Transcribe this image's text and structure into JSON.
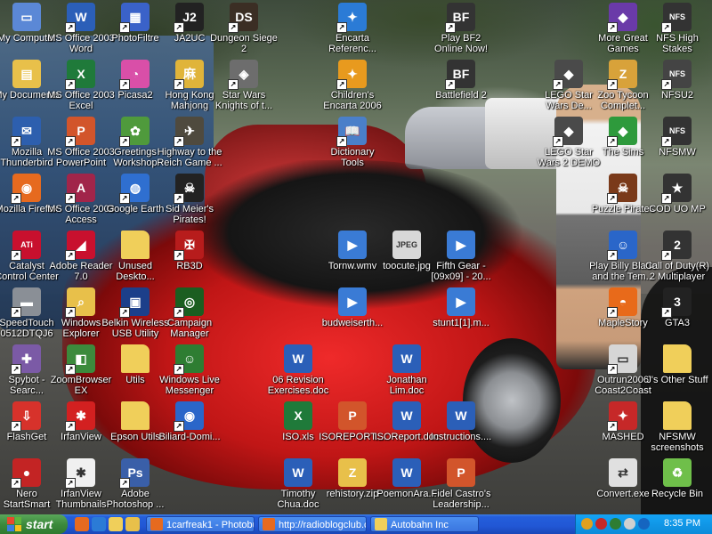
{
  "desktop": {
    "icons": [
      {
        "label": "My Computer",
        "icon": "computer-icon",
        "color": "#5b88d6",
        "glyph": "▭",
        "shortcut": false
      },
      {
        "label": "My Documents",
        "icon": "folder-documents-icon",
        "color": "#e8c04a",
        "glyph": "▤",
        "shortcut": false
      },
      {
        "label": "Mozilla Thunderbird",
        "icon": "thunderbird-icon",
        "color": "#2d5fae",
        "glyph": "✉",
        "shortcut": true
      },
      {
        "label": "Mozilla Firefox",
        "icon": "firefox-icon",
        "color": "#e66a1f",
        "glyph": "◉",
        "shortcut": true
      },
      {
        "label": "Catalyst Control Center",
        "icon": "ati-icon",
        "color": "#c8102e",
        "glyph": "ATi",
        "shortcut": true
      },
      {
        "label": "SpeedTouch 0512DTQJ6",
        "icon": "modem-icon",
        "color": "#8a8f96",
        "glyph": "▬",
        "shortcut": true
      },
      {
        "label": "Spybot - Searc...",
        "icon": "spybot-icon",
        "color": "#7b5aa6",
        "glyph": "✚",
        "shortcut": true
      },
      {
        "label": "FlashGet",
        "icon": "flashget-icon",
        "color": "#d7322b",
        "glyph": "⇩",
        "shortcut": true
      },
      {
        "label": "Nero StartSmart",
        "icon": "nero-icon",
        "color": "#c32424",
        "glyph": "●",
        "shortcut": true
      },
      {
        "label": "MS Office 2003 Word",
        "icon": "word-icon",
        "color": "#2b5fb8",
        "glyph": "W",
        "shortcut": true
      },
      {
        "label": "MS Office 2003 Excel",
        "icon": "excel-icon",
        "color": "#1f7a3a",
        "glyph": "X",
        "shortcut": true
      },
      {
        "label": "MS Office 2003 PowerPoint",
        "icon": "powerpoint-icon",
        "color": "#d2552b",
        "glyph": "P",
        "shortcut": true
      },
      {
        "label": "MS Office 2003 Access",
        "icon": "access-icon",
        "color": "#a1254a",
        "glyph": "A",
        "shortcut": true
      },
      {
        "label": "Adobe Reader 7.0",
        "icon": "adobe-reader-icon",
        "color": "#c8102e",
        "glyph": "◢",
        "shortcut": true
      },
      {
        "label": "Windows Explorer",
        "icon": "explorer-icon",
        "color": "#e8c04a",
        "glyph": "⌕",
        "shortcut": true
      },
      {
        "label": "ZoomBrowser EX",
        "icon": "zoombrowser-icon",
        "color": "#3c8a3c",
        "glyph": "◧",
        "shortcut": true
      },
      {
        "label": "IrfanView",
        "icon": "irfanview-icon",
        "color": "#d32020",
        "glyph": "✱",
        "shortcut": true
      },
      {
        "label": "IrfanView Thumbnails",
        "icon": "irfanview-thumbnails-icon",
        "color": "#f0f0f0",
        "glyph": "✱",
        "shortcut": true
      },
      {
        "label": "PhotoFiltre",
        "icon": "photofiltre-icon",
        "color": "#3a62c9",
        "glyph": "▦",
        "shortcut": true
      },
      {
        "label": "Picasa2",
        "icon": "picasa-icon",
        "color": "#d94fa8",
        "glyph": "◔",
        "shortcut": true
      },
      {
        "label": "Greetings Workshop",
        "icon": "greetings-icon",
        "color": "#4f9a3c",
        "glyph": "✿",
        "shortcut": true
      },
      {
        "label": "Google Earth",
        "icon": "google-earth-icon",
        "color": "#2f6fd0",
        "glyph": "◍",
        "shortcut": true
      },
      {
        "label": "Unused Deskto...",
        "icon": "folder-icon",
        "color": "#f0cf5a",
        "glyph": "",
        "shortcut": false
      },
      {
        "label": "Belkin Wireless USB Utility",
        "icon": "belkin-icon",
        "color": "#1c3f8a",
        "glyph": "▣",
        "shortcut": true
      },
      {
        "label": "Utils",
        "icon": "folder-icon",
        "color": "#f0cf5a",
        "glyph": "",
        "shortcut": false
      },
      {
        "label": "Epson Utils",
        "icon": "folder-icon",
        "color": "#f0cf5a",
        "glyph": "",
        "shortcut": false
      },
      {
        "label": "Adobe Photoshop ...",
        "icon": "photoshop-icon",
        "color": "#3a5fa8",
        "glyph": "Ps",
        "shortcut": true
      },
      {
        "label": "JA2UC",
        "icon": "ja2uc-icon",
        "color": "#222222",
        "glyph": "J2",
        "shortcut": true
      },
      {
        "label": "Hong Kong Mahjong",
        "icon": "mahjong-icon",
        "color": "#e0b43a",
        "glyph": "麻",
        "shortcut": true
      },
      {
        "label": "Highway to the Reich Game ...",
        "icon": "highway-reich-icon",
        "color": "#4f4a3e",
        "glyph": "✈",
        "shortcut": true
      },
      {
        "label": "Sid Meier's Pirates!",
        "icon": "pirates-icon",
        "color": "#222222",
        "glyph": "☠",
        "shortcut": true
      },
      {
        "label": "RB3D",
        "icon": "rb3d-icon",
        "color": "#b71c1c",
        "glyph": "✠",
        "shortcut": true
      },
      {
        "label": "Campaign Manager",
        "icon": "campaign-manager-icon",
        "color": "#1b5e20",
        "glyph": "◎",
        "shortcut": true
      },
      {
        "label": "Windows Live Messenger",
        "icon": "messenger-icon",
        "color": "#2e7d32",
        "glyph": "☺",
        "shortcut": true
      },
      {
        "label": "Biliard-Domi...",
        "icon": "billiard-icon",
        "color": "#2a66c9",
        "glyph": "◉",
        "shortcut": true
      },
      {
        "label": "Dungeon Siege 2",
        "icon": "dungeon-siege-icon",
        "color": "#3b2e24",
        "glyph": "DS",
        "shortcut": true
      },
      {
        "label": "Star Wars Knights of t...",
        "icon": "kotor-icon",
        "color": "#6d6d6d",
        "glyph": "◈",
        "shortcut": true
      },
      {
        "label": "Encarta Referenc...",
        "icon": "encarta-icon",
        "color": "#2b7bd6",
        "glyph": "✦",
        "shortcut": true
      },
      {
        "label": "Children's Encarta 2006",
        "icon": "childrens-encarta-icon",
        "color": "#e89a1e",
        "glyph": "✦",
        "shortcut": true
      },
      {
        "label": "Dictionary Tools",
        "icon": "dictionary-icon",
        "color": "#4a7fc9",
        "glyph": "📖",
        "shortcut": true
      },
      {
        "label": "Tornw.wmv",
        "icon": "video-file-icon",
        "color": "#3a7bd5",
        "glyph": "▶",
        "shortcut": false
      },
      {
        "label": "budweiserth...",
        "icon": "video-file-icon",
        "color": "#3a7bd5",
        "glyph": "▶",
        "shortcut": false
      },
      {
        "label": "06 Revision Exercises.doc",
        "icon": "word-doc-icon",
        "color": "#2b5fb8",
        "glyph": "W",
        "shortcut": false
      },
      {
        "label": "ISO.xls",
        "icon": "excel-doc-icon",
        "color": "#1f7a3a",
        "glyph": "X",
        "shortcut": false
      },
      {
        "label": "Timothy Chua.doc",
        "icon": "word-doc-icon",
        "color": "#2b5fb8",
        "glyph": "W",
        "shortcut": false
      },
      {
        "label": "toocute.jpg",
        "icon": "jpeg-file-icon",
        "color": "#d8d8d8",
        "glyph": "JPEG",
        "shortcut": false
      },
      {
        "label": "Jonathan Lim.doc",
        "icon": "word-doc-icon",
        "color": "#2b5fb8",
        "glyph": "W",
        "shortcut": false
      },
      {
        "label": "ISOREPORT....",
        "icon": "ppt-doc-icon",
        "color": "#d2552b",
        "glyph": "P",
        "shortcut": false
      },
      {
        "label": "ISOReport.doc",
        "icon": "word-doc-icon",
        "color": "#2b5fb8",
        "glyph": "W",
        "shortcut": false
      },
      {
        "label": "rehistory.zip",
        "icon": "zip-file-icon",
        "color": "#e8c04a",
        "glyph": "Z",
        "shortcut": false
      },
      {
        "label": "PoemonAra...",
        "icon": "word-doc-icon",
        "color": "#2b5fb8",
        "glyph": "W",
        "shortcut": false
      },
      {
        "label": "Play BF2 Online Now!",
        "icon": "battlefield-online-icon",
        "color": "#333333",
        "glyph": "BF",
        "shortcut": true
      },
      {
        "label": "Battlefield 2",
        "icon": "battlefield-icon",
        "color": "#333333",
        "glyph": "BF",
        "shortcut": true
      },
      {
        "label": "Fifth Gear - [09x09] - 20...",
        "icon": "video-file-icon",
        "color": "#3a7bd5",
        "glyph": "▶",
        "shortcut": false
      },
      {
        "label": "stunt1[1].m...",
        "icon": "video-file-icon",
        "color": "#3a7bd5",
        "glyph": "▶",
        "shortcut": false
      },
      {
        "label": "Instructions....",
        "icon": "word-doc-icon",
        "color": "#2b5fb8",
        "glyph": "W",
        "shortcut": false
      },
      {
        "label": "Fidel Castro's Leadership...",
        "icon": "ppt-doc-icon",
        "color": "#d2552b",
        "glyph": "P",
        "shortcut": false
      },
      {
        "label": "LEGO Star Wars De...",
        "icon": "lego-star-wars-icon",
        "color": "#4a4a4a",
        "glyph": "◆",
        "shortcut": true
      },
      {
        "label": "LEGO Star Wars 2 DEMO",
        "icon": "lego-star-wars-2-icon",
        "color": "#4a4a4a",
        "glyph": "◆",
        "shortcut": true
      },
      {
        "label": "More Great Games",
        "icon": "more-games-icon",
        "color": "#6a3aa8",
        "glyph": "◆",
        "shortcut": true
      },
      {
        "label": "Zoo Tycoon Complet...",
        "icon": "zoo-tycoon-icon",
        "color": "#d8a23a",
        "glyph": "Z",
        "shortcut": true
      },
      {
        "label": "The Sims",
        "icon": "sims-icon",
        "color": "#2e9a3c",
        "glyph": "◆",
        "shortcut": true
      },
      {
        "label": "Puzzle Pirates",
        "icon": "puzzle-pirates-icon",
        "color": "#7a3a1a",
        "glyph": "☠",
        "shortcut": true
      },
      {
        "label": "Play Billy Blade and the Tem...",
        "icon": "billy-blade-icon",
        "color": "#2a66c9",
        "glyph": "☺",
        "shortcut": true
      },
      {
        "label": "MapleStory",
        "icon": "maplestory-icon",
        "color": "#e86a1a",
        "glyph": "◓",
        "shortcut": true
      },
      {
        "label": "Outrun2006 Coast2Coast",
        "icon": "outrun-icon",
        "color": "#d6d6d6",
        "glyph": "▭",
        "shortcut": true
      },
      {
        "label": "MASHED",
        "icon": "mashed-icon",
        "color": "#c62828",
        "glyph": "✦",
        "shortcut": true
      },
      {
        "label": "Convert.exe",
        "icon": "convert-exe-icon",
        "color": "#e0e0e0",
        "glyph": "⇄",
        "shortcut": false
      },
      {
        "label": "NFS High Stakes",
        "icon": "nfs-high-stakes-icon",
        "color": "#333333",
        "glyph": "NFS",
        "shortcut": true
      },
      {
        "label": "NFSU2",
        "icon": "nfsu2-icon",
        "color": "#444444",
        "glyph": "NFS",
        "shortcut": true
      },
      {
        "label": "NFSMW",
        "icon": "nfsmw-icon",
        "color": "#333333",
        "glyph": "NFS",
        "shortcut": true
      },
      {
        "label": "COD UO MP",
        "icon": "cod-uo-icon",
        "color": "#333333",
        "glyph": "★",
        "shortcut": true
      },
      {
        "label": "Call of Duty(R) 2 Multiplayer",
        "icon": "cod2-icon",
        "color": "#333333",
        "glyph": "2",
        "shortcut": true
      },
      {
        "label": "GTA3",
        "icon": "gta3-icon",
        "color": "#222222",
        "glyph": "3",
        "shortcut": true
      },
      {
        "label": "J's Other Stuff",
        "icon": "folder-icon",
        "color": "#f0cf5a",
        "glyph": "",
        "shortcut": false
      },
      {
        "label": "NFSMW screenshots",
        "icon": "folder-icon",
        "color": "#f0cf5a",
        "glyph": "",
        "shortcut": false
      },
      {
        "label": "Recycle Bin",
        "icon": "recycle-bin-icon",
        "color": "#6fbf4a",
        "glyph": "♻",
        "shortcut": false
      }
    ]
  },
  "taskbar": {
    "start_label": "start",
    "quick_launch": [
      {
        "icon": "firefox-icon",
        "color": "#e66a1f"
      },
      {
        "icon": "ie-icon",
        "color": "#2b7bd6"
      },
      {
        "icon": "folder-icon",
        "color": "#f0cf5a"
      },
      {
        "icon": "media-icon",
        "color": "#e8c04a"
      }
    ],
    "tasks": [
      {
        "label": "1carfreak1 - Photobu...",
        "icon": "firefox-icon",
        "color": "#e66a1f",
        "active": false
      },
      {
        "label": "http://radioblogclub.c...",
        "icon": "firefox-icon",
        "color": "#e66a1f",
        "active": false
      },
      {
        "label": "Autobahn Inc",
        "icon": "folder-icon",
        "color": "#f0cf5a",
        "active": false
      }
    ],
    "tray_icons": [
      {
        "icon": "network-icon",
        "color": "#e0a020"
      },
      {
        "icon": "security-icon",
        "color": "#c62828"
      },
      {
        "icon": "messenger-tray-icon",
        "color": "#2e7d32"
      },
      {
        "icon": "volume-icon",
        "color": "#d0d0d0"
      },
      {
        "icon": "shield-tray-icon",
        "color": "#1565c0"
      }
    ],
    "clock": "8:35 PM"
  }
}
